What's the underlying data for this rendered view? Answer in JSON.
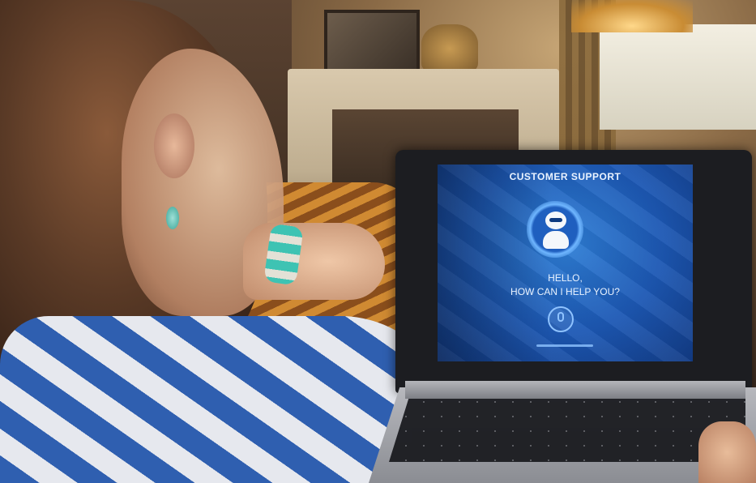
{
  "screen": {
    "title": "CUSTOMER SUPPORT",
    "greeting_line1": "HELLO,",
    "greeting_line2": "HOW CAN I HELP YOU?",
    "bot_icon": "robot-icon",
    "mic_icon": "microphone-icon"
  },
  "colors": {
    "screen_blue": "#1c57b3",
    "screen_text": "#eaf3ff",
    "accent_light_blue": "#8fc3ff"
  }
}
